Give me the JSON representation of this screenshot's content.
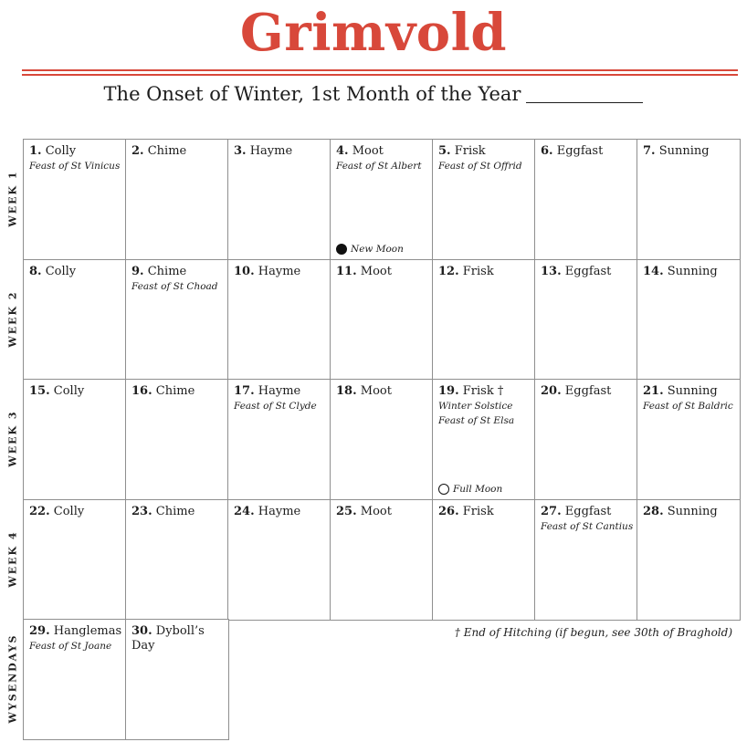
{
  "header": {
    "title": "Grimvold",
    "subtitle": "The Onset of Winter, 1st Month of the Year"
  },
  "rows": [
    {
      "label": "WEEK 1",
      "days": [
        {
          "num": "1.",
          "name": "Colly",
          "note": "Feast of St Vinicus"
        },
        {
          "num": "2.",
          "name": "Chime"
        },
        {
          "num": "3.",
          "name": "Hayme"
        },
        {
          "num": "4.",
          "name": "Moot",
          "note": "Feast of St Albert",
          "moon": "New Moon"
        },
        {
          "num": "5.",
          "name": "Frisk",
          "note": "Feast of St Offrid"
        },
        {
          "num": "6.",
          "name": "Eggfast"
        },
        {
          "num": "7.",
          "name": "Sunning"
        }
      ]
    },
    {
      "label": "WEEK 2",
      "days": [
        {
          "num": "8.",
          "name": "Colly"
        },
        {
          "num": "9.",
          "name": "Chime",
          "note": "Feast of St Choad"
        },
        {
          "num": "10.",
          "name": "Hayme"
        },
        {
          "num": "11.",
          "name": "Moot"
        },
        {
          "num": "12.",
          "name": "Frisk"
        },
        {
          "num": "13.",
          "name": "Eggfast"
        },
        {
          "num": "14.",
          "name": "Sunning"
        }
      ]
    },
    {
      "label": "WEEK 3",
      "days": [
        {
          "num": "15.",
          "name": "Colly"
        },
        {
          "num": "16.",
          "name": "Chime"
        },
        {
          "num": "17.",
          "name": "Hayme",
          "note": "Feast of St Clyde"
        },
        {
          "num": "18.",
          "name": "Moot"
        },
        {
          "num": "19.",
          "name": "Frisk †",
          "note": "Winter Solstice",
          "note2": "Feast of St Elsa",
          "moon": "Full Moon"
        },
        {
          "num": "20.",
          "name": "Eggfast"
        },
        {
          "num": "21.",
          "name": "Sunning",
          "note": "Feast of St Baldric"
        }
      ]
    },
    {
      "label": "WEEK 4",
      "days": [
        {
          "num": "22.",
          "name": "Colly"
        },
        {
          "num": "23.",
          "name": "Chime"
        },
        {
          "num": "24.",
          "name": "Hayme"
        },
        {
          "num": "25.",
          "name": "Moot"
        },
        {
          "num": "26.",
          "name": "Frisk"
        },
        {
          "num": "27.",
          "name": "Eggfast",
          "note": "Feast of St Cantius"
        },
        {
          "num": "28.",
          "name": "Sunning"
        }
      ]
    },
    {
      "label": "WYSENDAYS",
      "days": [
        {
          "num": "29.",
          "name": "Hanglemas",
          "note": "Feast of St Joane"
        },
        {
          "num": "30.",
          "name": "Dyboll’s Day"
        }
      ]
    }
  ],
  "footnote": "† End of Hitching (if begun, see 30th of Braghold)",
  "colors": {
    "title": "#d8483a",
    "rule": "#d8483a",
    "grid": "#8f8f8f",
    "text": "#1d1d1d"
  }
}
